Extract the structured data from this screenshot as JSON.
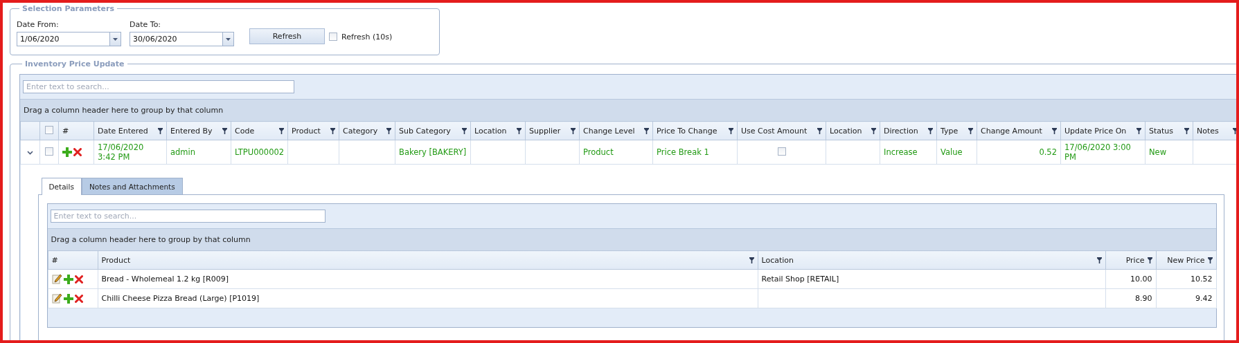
{
  "selection": {
    "title": "Selection Parameters",
    "date_from": {
      "label": "Date From:",
      "value": "1/06/2020"
    },
    "date_to": {
      "label": "Date To:",
      "value": "30/06/2020"
    },
    "refresh_button": "Refresh",
    "auto_refresh": {
      "label": "Refresh (10s)",
      "checked": false
    }
  },
  "inventory": {
    "title": "Inventory Price Update",
    "search": {
      "placeholder": "Enter text to search..."
    },
    "group_hint": "Drag a column header here to group by that column",
    "columns": [
      {
        "kind": "expand"
      },
      {
        "kind": "select",
        "checked": false
      },
      {
        "label": "#",
        "filter": false
      },
      {
        "label": "Date Entered",
        "filter": true
      },
      {
        "label": "Entered By",
        "filter": true
      },
      {
        "label": "Code",
        "filter": true
      },
      {
        "label": "Product",
        "filter": true
      },
      {
        "label": "Category",
        "filter": true
      },
      {
        "label": "Sub Category",
        "filter": true
      },
      {
        "label": "Location",
        "filter": true
      },
      {
        "label": "Supplier",
        "filter": true
      },
      {
        "label": "Change Level",
        "filter": true
      },
      {
        "label": "Price To Change",
        "filter": true
      },
      {
        "label": "Use Cost Amount",
        "filter": true
      },
      {
        "label": "Location",
        "filter": true
      },
      {
        "label": "Direction",
        "filter": true
      },
      {
        "label": "Type",
        "filter": true
      },
      {
        "label": "Change Amount",
        "filter": true
      },
      {
        "label": "Update Price On",
        "filter": true
      },
      {
        "label": "Status",
        "filter": true
      },
      {
        "label": "Notes",
        "filter": true
      }
    ],
    "rows": [
      {
        "cells": [
          {
            "kind": "expand",
            "expanded": true
          },
          {
            "kind": "checkbox",
            "checked": false
          },
          {
            "kind": "actions"
          },
          {
            "text": "17/06/2020 3:42 PM"
          },
          {
            "text": "admin"
          },
          {
            "text": "LTPU000002"
          },
          null,
          null,
          {
            "text": "Bakery [BAKERY]"
          },
          null,
          null,
          {
            "text": "Product"
          },
          {
            "text": "Price Break 1"
          },
          {
            "kind": "checkbox",
            "checked": false
          },
          null,
          {
            "text": "Increase"
          },
          {
            "text": "Value"
          },
          {
            "kind": "number",
            "text": "0.52"
          },
          {
            "text": "17/06/2020 3:00 PM"
          },
          {
            "text": "New"
          },
          null
        ]
      }
    ],
    "detail": {
      "tabs": [
        {
          "label": "Details",
          "selected": true
        },
        {
          "label": "Notes and Attachments",
          "selected": false
        }
      ],
      "search": {
        "placeholder": "Enter text to search..."
      },
      "group_hint": "Drag a column header here to group by that column",
      "columns": [
        {
          "label": "#",
          "filter": false
        },
        {
          "label": "Product",
          "filter": true
        },
        {
          "label": "Location",
          "filter": true
        },
        {
          "label": "Price",
          "filter": true,
          "kind": "number"
        },
        {
          "label": "New Price",
          "filter": true,
          "kind": "number"
        }
      ],
      "rows": [
        {
          "product": "Bread - Wholemeal 1.2 kg [R009]",
          "location": "Retail Shop [RETAIL]",
          "price": "10.00",
          "new_price": "10.52"
        },
        {
          "product": "Chilli Cheese Pizza Bread (Large) [P1019]",
          "price": "8.90",
          "new_price": "9.42"
        }
      ]
    }
  }
}
